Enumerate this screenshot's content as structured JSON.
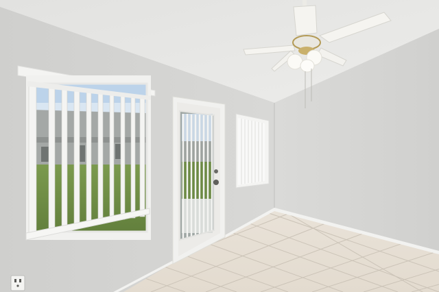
{
  "scene": {
    "colors": {
      "left_wall": "#d3d3d1",
      "back_wall": "#dad9d6",
      "right_wall": "#d6d5d3",
      "ceiling": "#e8e8e6",
      "floor_tile": "#e6ded3",
      "grout": "#c9c1b6",
      "baseboard": "#f2f2f0",
      "trim": "#f4f4f2",
      "sky": "#bcd3ea",
      "lawn": "#6f8f46",
      "neighbor_house": "#a4a8a6",
      "blinds": "#f3f3f1"
    },
    "icons": [
      "ceiling-fan-icon",
      "electrical-outlet-icon"
    ]
  }
}
